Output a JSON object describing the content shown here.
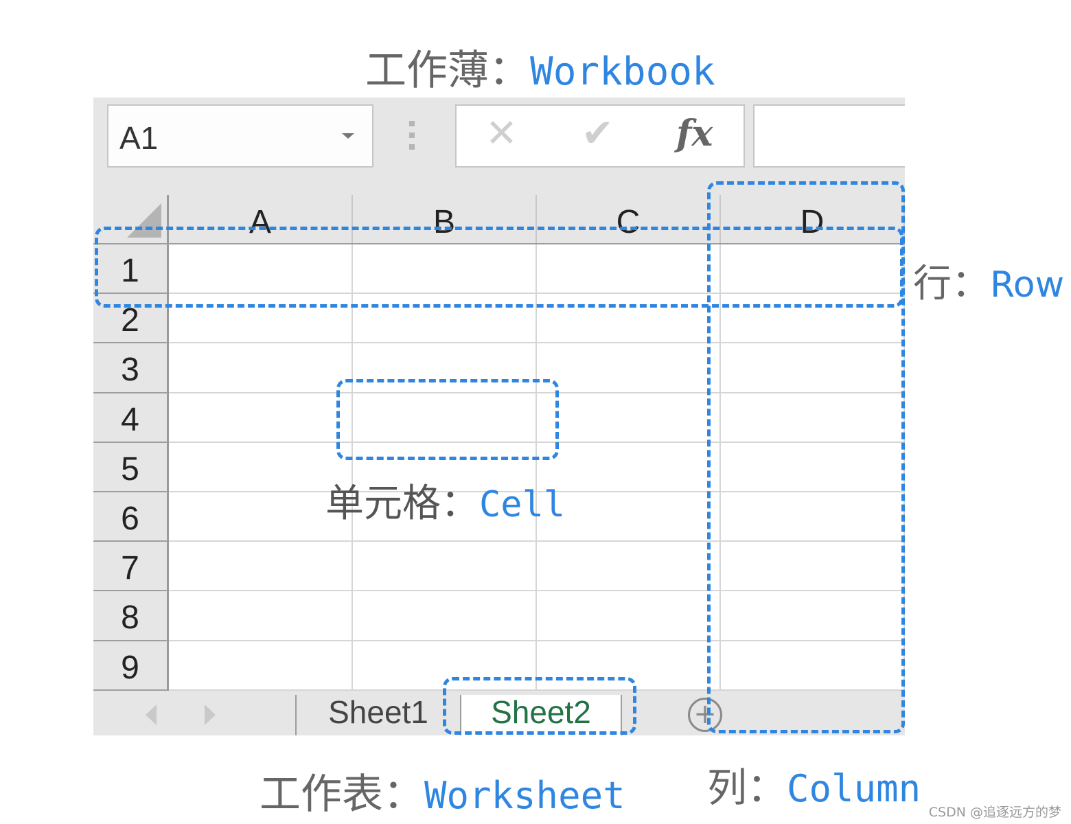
{
  "annotations": {
    "workbook": {
      "cn": "工作薄",
      "sep": "：",
      "en": "Workbook"
    },
    "row": {
      "cn": "行",
      "sep": "：",
      "en": "Row"
    },
    "cell": {
      "cn": "单元格",
      "sep": "：",
      "en": "Cell"
    },
    "worksheet": {
      "cn": "工作表",
      "sep": "：",
      "en": "Worksheet"
    },
    "column": {
      "cn": "列",
      "sep": "：",
      "en": "Column"
    }
  },
  "excel": {
    "name_box": {
      "value": "A1",
      "icon": "chevron-down-icon"
    },
    "formula_bar": {
      "cancel_icon": "✕",
      "enter_icon": "✔",
      "fx_label": "fx",
      "value": ""
    },
    "columns": [
      "A",
      "B",
      "C",
      "D"
    ],
    "rows": [
      "1",
      "2",
      "3",
      "4",
      "5",
      "6",
      "7",
      "8",
      "9"
    ],
    "sheets": [
      {
        "name": "Sheet1",
        "active": false
      },
      {
        "name": "Sheet2",
        "active": true
      }
    ],
    "add_sheet_label": "+",
    "colors": {
      "accent": "#2f86e0",
      "active_sheet": "#217346"
    }
  },
  "watermark": "CSDN @追逐远方的梦"
}
